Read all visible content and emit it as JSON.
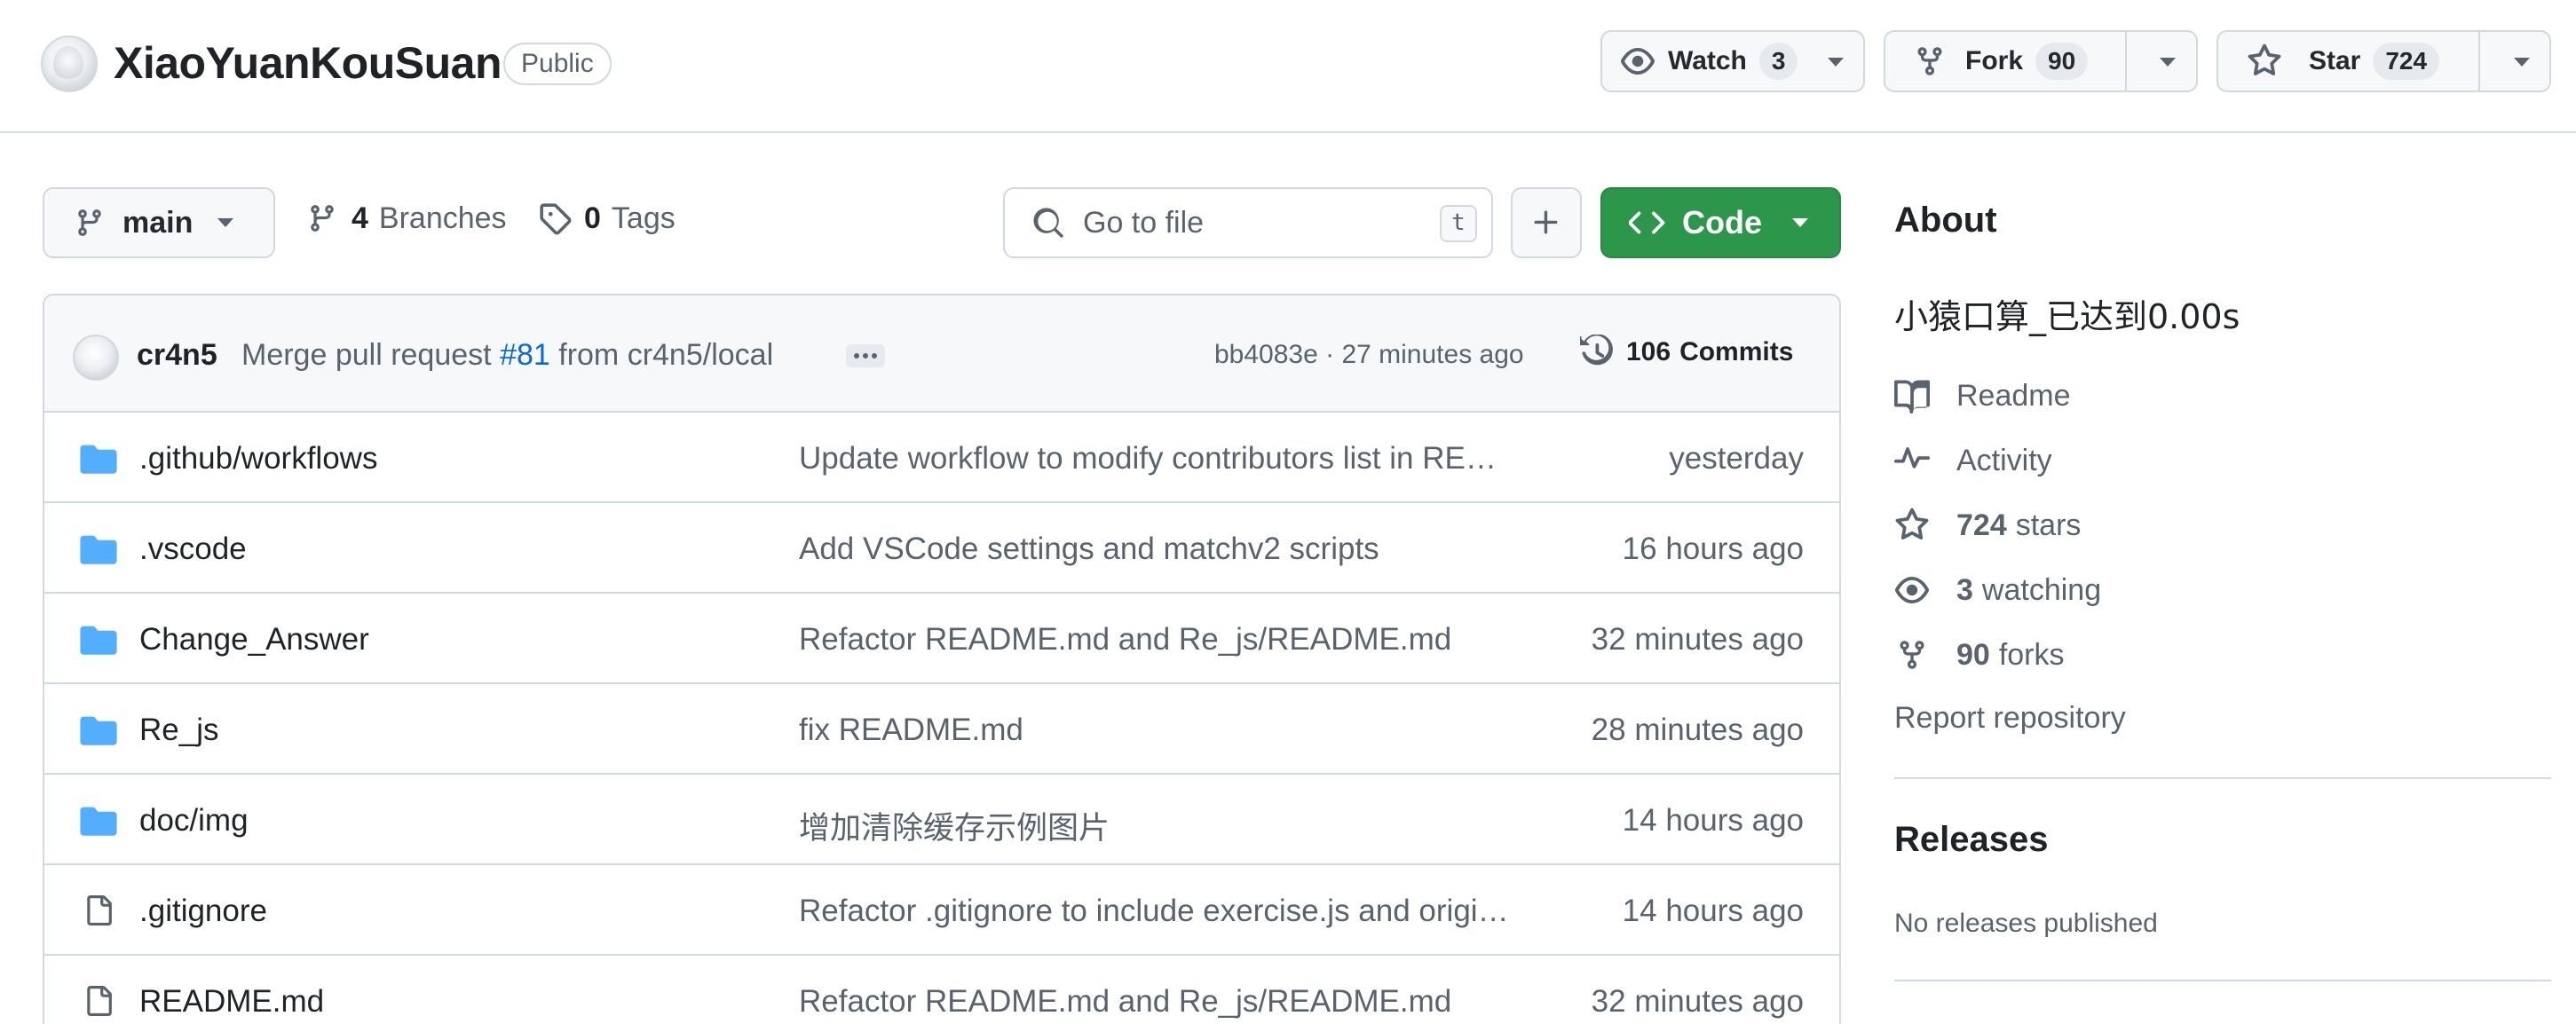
{
  "repo": {
    "name": "XiaoYuanKouSuan",
    "visibility": "Public"
  },
  "actions": {
    "watch": {
      "label": "Watch",
      "count": "3"
    },
    "fork": {
      "label": "Fork",
      "count": "90"
    },
    "star": {
      "label": "Star",
      "count": "724"
    }
  },
  "toolbar": {
    "branch": "main",
    "branches_count": "4",
    "branches_label": "Branches",
    "tags_count": "0",
    "tags_label": "Tags",
    "search_placeholder": "Go to file",
    "search_shortcut": "t",
    "code_label": "Code"
  },
  "latest_commit": {
    "author": "cr4n5",
    "message_prefix": "Merge pull request",
    "pr": "#81",
    "message_suffix": "from cr4n5/local",
    "meta": "bb4083e · 27 minutes ago",
    "commits_count": "106",
    "commits_label": "Commits"
  },
  "files": [
    {
      "type": "folder",
      "name": ".github/workflows",
      "message": "Update workflow to modify contributors list in RE…",
      "time": "yesterday"
    },
    {
      "type": "folder",
      "name": ".vscode",
      "message": "Add VSCode settings and matchv2 scripts",
      "time": "16 hours ago"
    },
    {
      "type": "folder",
      "name": "Change_Answer",
      "message": "Refactor README.md and Re_js/README.md",
      "time": "32 minutes ago"
    },
    {
      "type": "folder",
      "name": "Re_js",
      "message": "fix README.md",
      "time": "28 minutes ago"
    },
    {
      "type": "folder",
      "name": "doc/img",
      "message": "增加清除缓存示例图片",
      "time": "14 hours ago"
    },
    {
      "type": "file",
      "name": ".gitignore",
      "message": "Refactor .gitignore to include exercise.js and origi…",
      "time": "14 hours ago"
    },
    {
      "type": "file",
      "name": "README.md",
      "message": "Refactor README.md and Re_js/README.md",
      "time": "32 minutes ago"
    }
  ],
  "about": {
    "title": "About",
    "description": "小猿口算_已达到0.00s",
    "readme": "Readme",
    "activity": "Activity",
    "stars_count": "724",
    "stars_label": "stars",
    "watching_count": "3",
    "watching_label": "watching",
    "forks_count": "90",
    "forks_label": "forks",
    "report": "Report repository"
  },
  "releases": {
    "title": "Releases",
    "empty": "No releases published"
  },
  "colors": {
    "accent_link": "#0969da",
    "code_button": "#2c974b",
    "folder_icon": "#54aeff",
    "border": "#d1d9e0",
    "muted_text": "#59636e"
  }
}
